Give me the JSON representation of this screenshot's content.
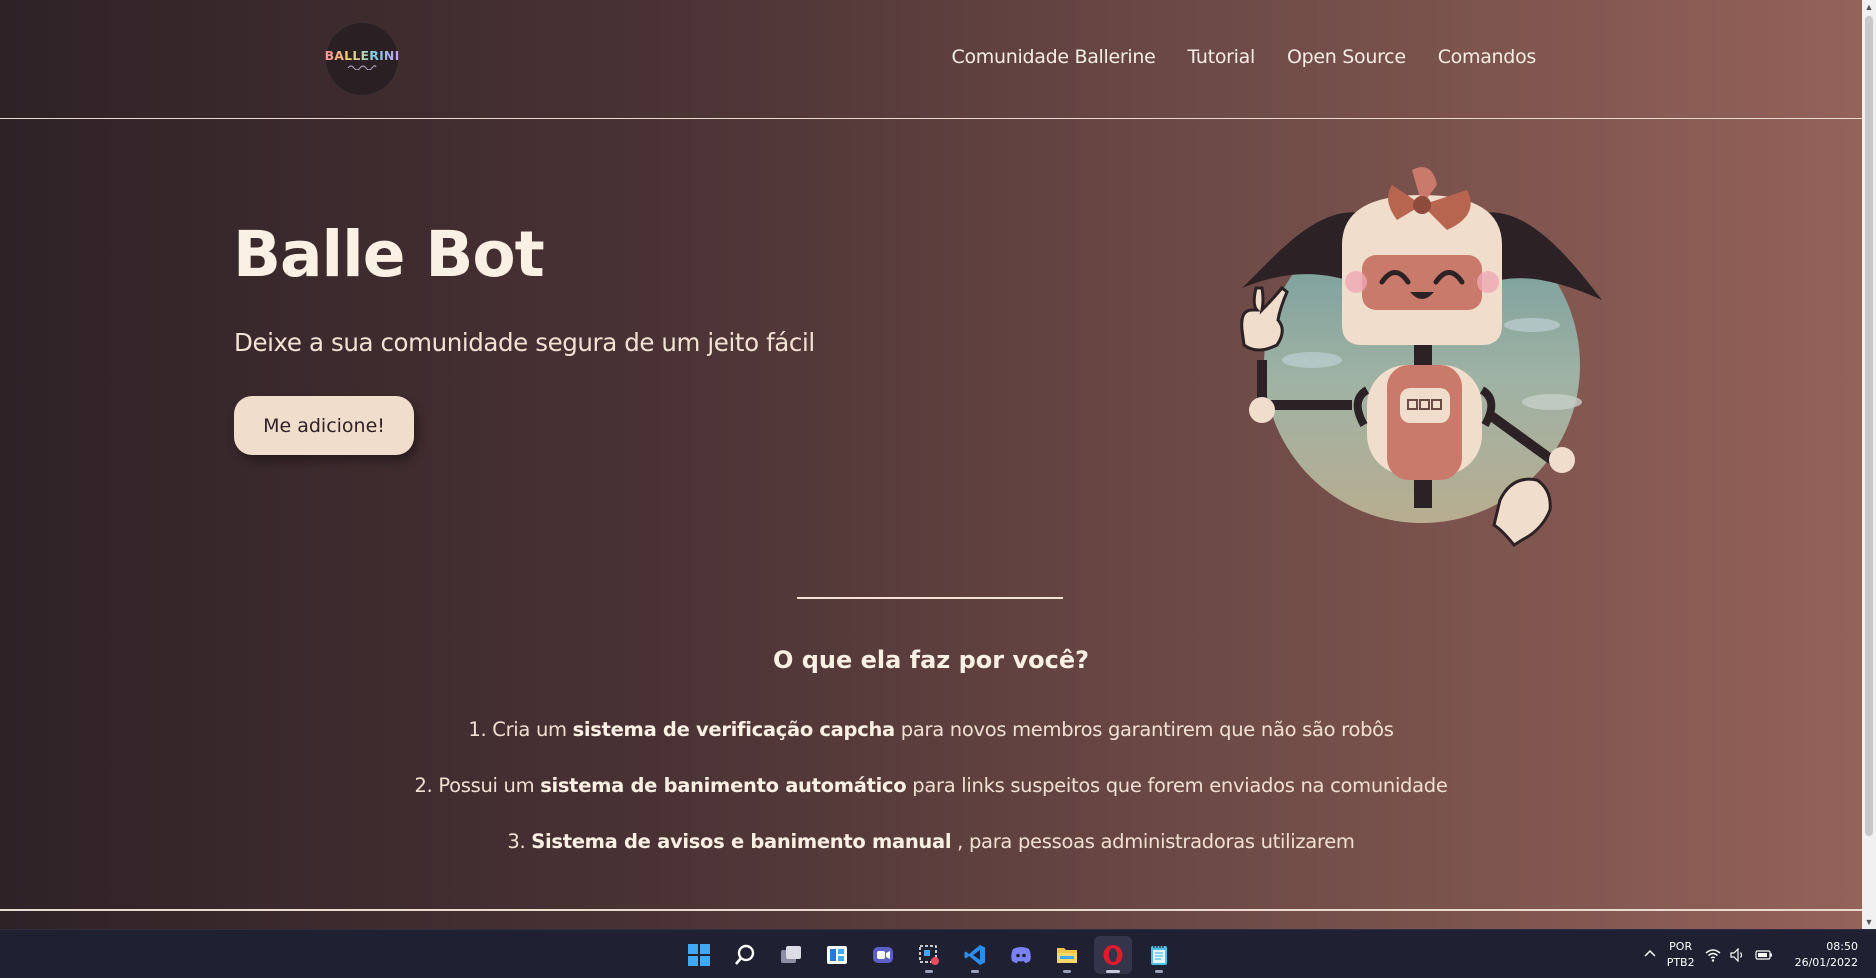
{
  "header": {
    "logo_text": "BALLERINI",
    "nav": [
      {
        "label": "Comunidade Ballerine"
      },
      {
        "label": "Tutorial"
      },
      {
        "label": "Open Source"
      },
      {
        "label": "Comandos"
      }
    ]
  },
  "hero": {
    "title": "Balle Bot",
    "subtitle": "Deixe a sua comunidade segura de um jeito fácil",
    "cta_label": "Me adicione!"
  },
  "features": {
    "title": "O que ela faz por você?",
    "items": [
      {
        "prefix": "1. Cria um ",
        "bold": "sistema de verificação capcha",
        "suffix": " para novos membros garantirem que não são robôs"
      },
      {
        "prefix": "2. Possui um ",
        "bold": "sistema de banimento automático",
        "suffix": " para links suspeitos que forem enviados na comunidade"
      },
      {
        "prefix": "3. ",
        "bold": "Sistema de avisos e banimento manual",
        "suffix": " , para pessoas administradoras utilizarem"
      }
    ]
  },
  "colors": {
    "gradient_start": "#2e2227",
    "gradient_end": "#946259",
    "button_bg": "#f0ddcc",
    "text_light": "#fbf0e4"
  },
  "taskbar": {
    "apps": [
      {
        "icon": "windows-start-icon"
      },
      {
        "icon": "search-icon"
      },
      {
        "icon": "task-view-icon"
      },
      {
        "icon": "widgets-icon"
      },
      {
        "icon": "teams-chat-icon"
      },
      {
        "icon": "snipping-tool-icon"
      },
      {
        "icon": "vscode-icon"
      },
      {
        "icon": "discord-icon"
      },
      {
        "icon": "file-explorer-icon"
      },
      {
        "icon": "opera-browser-icon"
      },
      {
        "icon": "notepad-icon"
      }
    ],
    "language_top": "POR",
    "language_bottom": "PTB2",
    "time": "08:50",
    "date": "26/01/2022"
  }
}
